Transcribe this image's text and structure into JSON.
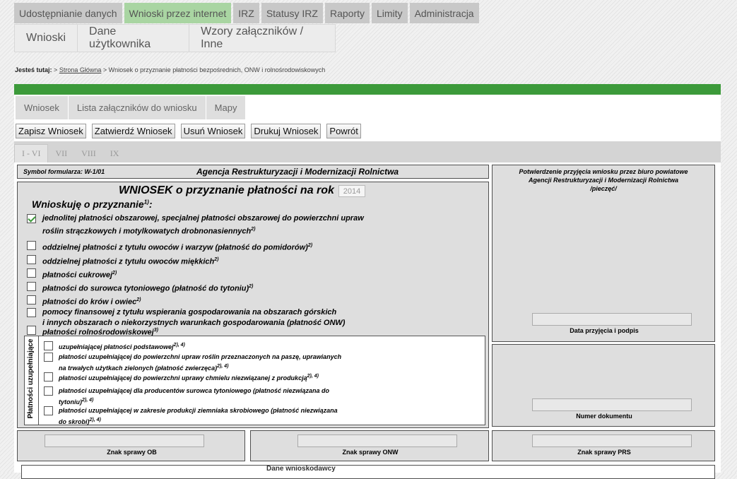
{
  "top_nav": [
    "Udostępnianie danych",
    "Wnioski przez internet",
    "IRZ",
    "Statusy IRZ",
    "Raporty",
    "Limity",
    "Administracja"
  ],
  "sub_nav": [
    "Wnioski",
    "Dane użytkownika",
    "Wzory załączników / Inne"
  ],
  "breadcrumb": {
    "prefix": "Jesteś tutaj:",
    "sep": ">",
    "home": "Strona Główna",
    "current": "> Wniosek o przyznanie płatności bezpośrednich, ONW i rolnośrodowiskowych"
  },
  "form_tabs": [
    "Wniosek",
    "Lista załączników do wniosku",
    "Mapy"
  ],
  "buttons": [
    "Zapisz Wniosek",
    "Zatwierdź Wniosek",
    "Usuń Wniosek",
    "Drukuj Wniosek",
    "Powrót"
  ],
  "page_tabs": [
    "I - VI",
    "VII",
    "VIII",
    "IX"
  ],
  "form": {
    "symbol": "Symbol formularza: W-1/01",
    "agency": "Agencja Restrukturyzacji i Modernizacji Rolnictwa",
    "title": "WNIOSEK o przyznanie płatności na rok",
    "year": "2014",
    "subheading": "Wnioskuję o przyznanie",
    "subheading_sup": "1)",
    "items": [
      {
        "lines": [
          "jednolitej płatności obszarowej, specjalnej płatności obszarowej do powierzchni upraw",
          "roślin strączkowych i motylkowatych drobnonasiennych"
        ],
        "sup": "2)",
        "checked": true
      },
      {
        "lines": [
          "oddzielnej płatności z tytułu owoców i warzyw (płatność do pomidorów)"
        ],
        "sup": "2)",
        "checked": false
      },
      {
        "lines": [
          "oddzielnej płatności z tytułu owoców miękkich"
        ],
        "sup": "2)",
        "checked": false
      },
      {
        "lines": [
          "płatności cukrowej"
        ],
        "sup": "2)",
        "checked": false
      },
      {
        "lines": [
          "płatności do surowca tytoniowego (płatność do tytoniu)"
        ],
        "sup": "2)",
        "checked": false
      },
      {
        "lines": [
          "płatności do krów i owiec"
        ],
        "sup": "2)",
        "checked": false
      },
      {
        "lines": [
          "pomocy finansowej z tytułu wspierania gospodarowania na obszarach górskich",
          "i innych obszarach o niekorzystnych warunkach gospodarowania (płatność ONW)"
        ],
        "sup": "",
        "checked": false
      },
      {
        "lines": [
          "płatności rolnośrodowiskowej"
        ],
        "sup": "3)",
        "checked": false
      }
    ],
    "supplementary_label": "Płatności uzupełniające",
    "supplementary": [
      {
        "lines": [
          "uzupełniającej płatności podstawowej"
        ],
        "sup": "2), 4)",
        "checked": false
      },
      {
        "lines": [
          "płatności uzupełniającej do powierzchni upraw roślin przeznaczonych na paszę, uprawianych",
          "na trwałych użytkach zielonych (płatność zwierzęca)"
        ],
        "sup": "2), 4)",
        "checked": false
      },
      {
        "lines": [
          "płatności uzupełniającej do powierzchni uprawy chmielu niezwiązanej z produkcją"
        ],
        "sup": "2), 4)",
        "checked": false
      },
      {
        "lines": [
          "płatności uzupełniającej dla producentów surowca tytoniowego (płatność niezwiązana do",
          "tytoniu)"
        ],
        "sup": "2), 4)",
        "checked": false
      },
      {
        "lines": [
          "płatności uzupełniającej w zakresie produkcji ziemniaka skrobiowego (płatność niezwiązana",
          "do skrobi)"
        ],
        "sup": "2), 4)",
        "checked": false
      }
    ],
    "confirmation_lines": [
      "Potwierdzenie przyjęcia wniosku przez biuro powiatowe",
      "Agencji Restrukturyzacji i Modernizacji Rolnictwa",
      "/pieczęć/"
    ],
    "date_label": "Data przyjęcia i podpis",
    "doc_number_label": "Numer dokumentu",
    "case_ob": "Znak sprawy OB",
    "case_onw": "Znak sprawy ONW",
    "case_prs": "Znak sprawy PRS",
    "bottom_title": "Dane wnioskodawcy"
  },
  "colors": {
    "green_bar": "#3c9a3a",
    "active_tab": "#a9d5a2"
  }
}
